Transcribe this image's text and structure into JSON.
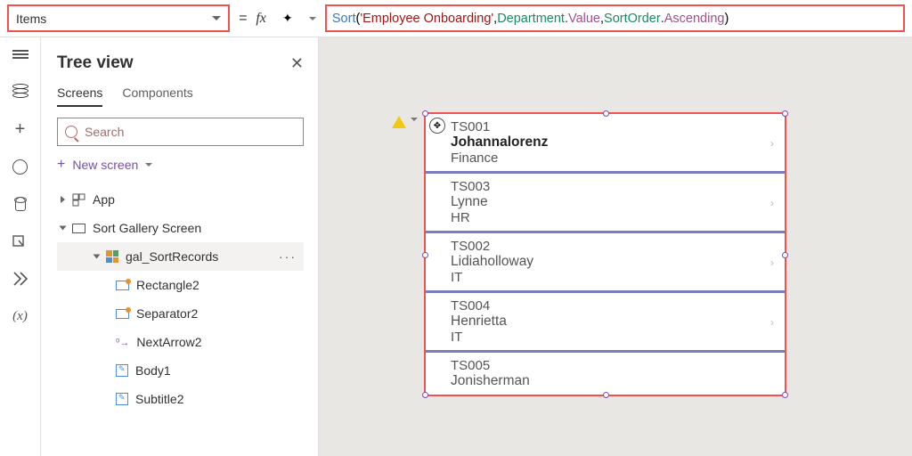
{
  "property_selector": {
    "value": "Items"
  },
  "formula": {
    "equals": "=",
    "fx": "fx",
    "tokens": {
      "fn": "Sort",
      "open": "(",
      "str": "'Employee Onboarding'",
      "c1": ",",
      "id1": "Department",
      "dot1": ".",
      "prop1": "Value",
      "c2": ",",
      "id2": "SortOrder",
      "dot2": ".",
      "prop2": "Ascending",
      "close": ")"
    }
  },
  "tree": {
    "title": "Tree view",
    "tabs": {
      "screens": "Screens",
      "components": "Components"
    },
    "search_placeholder": "Search",
    "new_screen": "New screen",
    "nodes": {
      "app": "App",
      "screen": "Sort Gallery Screen",
      "gallery": "gal_SortRecords",
      "rect": "Rectangle2",
      "sep": "Separator2",
      "next": "NextArrow2",
      "body": "Body1",
      "sub": "Subtitle2"
    },
    "more": "···"
  },
  "gallery_rows": [
    {
      "id": "TS001",
      "name": "Johannalorenz",
      "dept": "Finance"
    },
    {
      "id": "TS003",
      "name": "Lynne",
      "dept": "HR"
    },
    {
      "id": "TS002",
      "name": "Lidiaholloway",
      "dept": "IT"
    },
    {
      "id": "TS004",
      "name": "Henrietta",
      "dept": "IT"
    },
    {
      "id": "TS005",
      "name": "Jonisherman",
      "dept": ""
    }
  ],
  "icons": {
    "copilot": "✦"
  }
}
